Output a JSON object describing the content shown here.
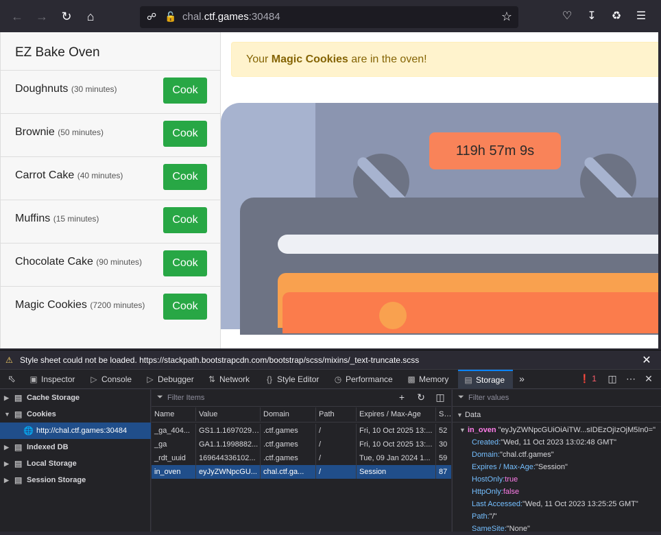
{
  "browser": {
    "url_host_prefix": "chal.",
    "url_host_main": "ctf.games",
    "url_port": ":30484"
  },
  "app": {
    "title": "EZ Bake Oven",
    "items": [
      {
        "name": "Doughnuts",
        "duration": "(30 minutes)",
        "button": "Cook"
      },
      {
        "name": "Brownie",
        "duration": "(50 minutes)",
        "button": "Cook"
      },
      {
        "name": "Carrot Cake",
        "duration": "(40 minutes)",
        "button": "Cook"
      },
      {
        "name": "Muffins",
        "duration": "(15 minutes)",
        "button": "Cook"
      },
      {
        "name": "Chocolate Cake",
        "duration": "(90 minutes)",
        "button": "Cook"
      },
      {
        "name": "Magic Cookies",
        "duration": "(7200 minutes)",
        "button": "Cook"
      }
    ],
    "alert_prefix": "Your ",
    "alert_bold": "Magic Cookies",
    "alert_suffix": " are in the oven!",
    "timer": "119h 57m 9s"
  },
  "console": {
    "message": "Style sheet could not be loaded. https://stackpath.bootstrapcdn.com/bootstrap/scss/mixins/_text-truncate.scss"
  },
  "devtools": {
    "tabs": [
      "Inspector",
      "Console",
      "Debugger",
      "Network",
      "Style Editor",
      "Performance",
      "Memory",
      "Storage"
    ],
    "active_tab": "Storage",
    "error_count": "1",
    "tree": [
      {
        "label": "Cache Storage"
      },
      {
        "label": "Cookies"
      },
      {
        "label": "http://chal.ctf.games:30484"
      },
      {
        "label": "Indexed DB"
      },
      {
        "label": "Local Storage"
      },
      {
        "label": "Session Storage"
      }
    ],
    "filter_items_placeholder": "Filter Items",
    "filter_values_placeholder": "Filter values",
    "columns": [
      "Name",
      "Value",
      "Domain",
      "Path",
      "Expires / Max-Age",
      "Size"
    ],
    "rows": [
      {
        "name": "_ga_404...",
        "value": "GS1.1.169702920...",
        "domain": ".ctf.games",
        "path": "/",
        "expires": "Fri, 10 Oct 2025 13:...",
        "size": "52"
      },
      {
        "name": "_ga",
        "value": "GA1.1.1998882...",
        "domain": ".ctf.games",
        "path": "/",
        "expires": "Fri, 10 Oct 2025 13:...",
        "size": "30"
      },
      {
        "name": "_rdt_uuid",
        "value": "169644336102...",
        "domain": ".ctf.games",
        "path": "/",
        "expires": "Tue, 09 Jan 2024 1...",
        "size": "59"
      },
      {
        "name": "in_oven",
        "value": "eyJyZWNpcGU...",
        "domain": "chal.ctf.ga...",
        "path": "/",
        "expires": "Session",
        "size": "87"
      }
    ],
    "data_header": "Data",
    "data": {
      "key": "in_oven",
      "value": "\"eyJyZWNpcGUiOiAiTW...sIDEzOjIzOjM5In0=\"",
      "created_k": "Created:",
      "created_v": "\"Wed, 11 Oct 2023 13:02:48 GMT\"",
      "domain_k": "Domain:",
      "domain_v": "\"chal.ctf.games\"",
      "expires_k": "Expires / Max-Age:",
      "expires_v": "\"Session\"",
      "hostonly_k": "HostOnly:",
      "hostonly_v": "true",
      "httponly_k": "HttpOnly:",
      "httponly_v": "false",
      "lastaccessed_k": "Last Accessed:",
      "lastaccessed_v": "\"Wed, 11 Oct 2023 13:25:25 GMT\"",
      "path_k": "Path:",
      "path_v": "\"/\"",
      "samesite_k": "SameSite:",
      "samesite_v": "\"None\""
    }
  }
}
